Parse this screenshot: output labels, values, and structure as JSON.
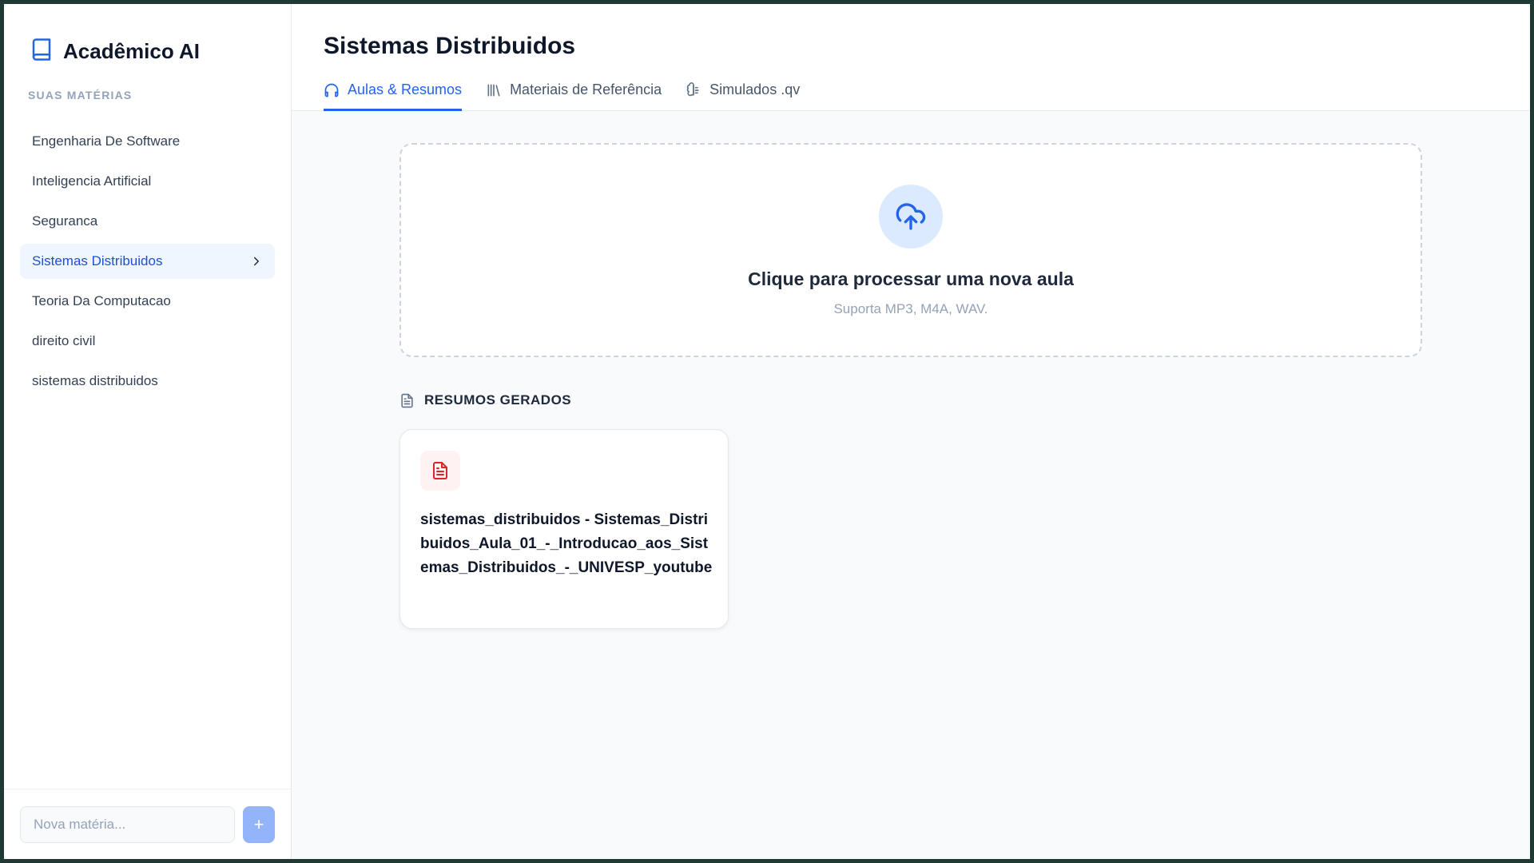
{
  "app": {
    "name": "Acadêmico AI",
    "icon": "book-icon"
  },
  "sidebar": {
    "section_label": "SUAS MATÉRIAS",
    "subjects": [
      {
        "label": "Engenharia De Software",
        "active": false
      },
      {
        "label": "Inteligencia Artificial",
        "active": false
      },
      {
        "label": "Seguranca",
        "active": false
      },
      {
        "label": "Sistemas Distribuidos",
        "active": true
      },
      {
        "label": "Teoria Da Computacao",
        "active": false
      },
      {
        "label": "direito civil",
        "active": false
      },
      {
        "label": "sistemas distribuidos",
        "active": false
      }
    ],
    "new_subject": {
      "placeholder": "Nova matéria...",
      "value": "",
      "add_label": "+"
    }
  },
  "main": {
    "title": "Sistemas Distribuidos",
    "tabs": [
      {
        "label": "Aulas & Resumos",
        "icon": "headphones-icon",
        "active": true
      },
      {
        "label": "Materiais de Referência",
        "icon": "library-icon",
        "active": false
      },
      {
        "label": "Simulados .qv",
        "icon": "brain-icon",
        "active": false
      }
    ],
    "upload": {
      "icon": "cloud-upload-icon",
      "title": "Clique para processar uma nova aula",
      "subtitle": "Suporta MP3, M4A, WAV."
    },
    "summaries": {
      "heading": "RESUMOS GERADOS",
      "icon": "document-icon",
      "items": [
        {
          "title": "sistemas_distribuidos - Sistemas_Distribuidos_Aula_01_-_Introducao_aos_Sistemas_Distribuidos_-_UNIVESP_youtube",
          "icon": "file-text-icon"
        }
      ]
    }
  },
  "colors": {
    "accent": "#2563eb",
    "active_bg": "#eff6ff",
    "file_icon": "#dc2626"
  }
}
